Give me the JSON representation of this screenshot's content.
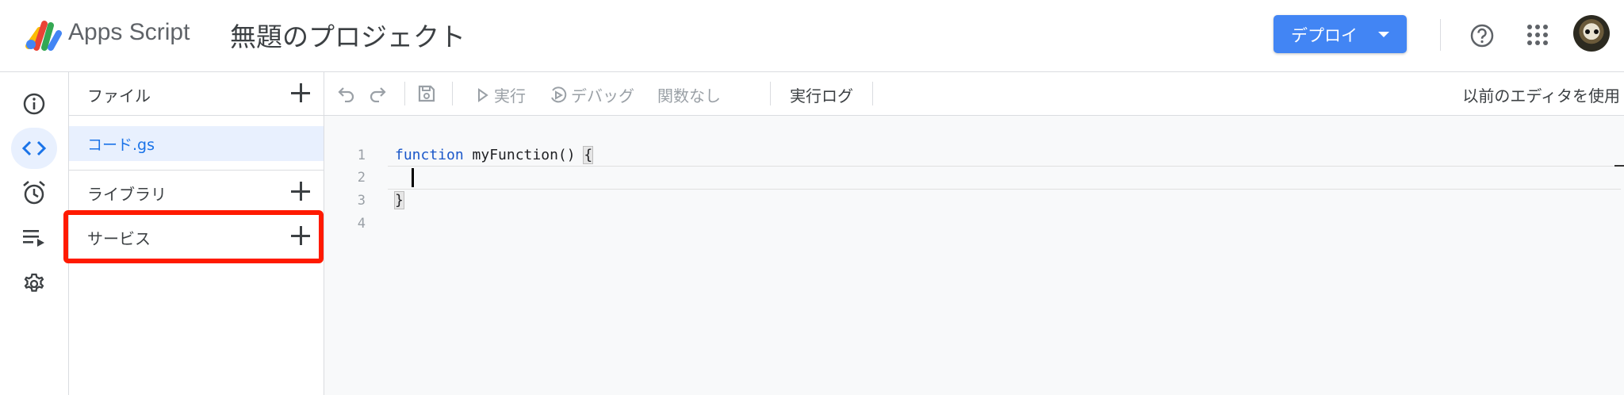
{
  "header": {
    "app_name": "Apps Script",
    "project_title": "無題のプロジェクト",
    "deploy_label": "デプロイ",
    "icons": [
      "apps-script-logo",
      "help-icon",
      "apps-grid-icon",
      "avatar"
    ]
  },
  "rail": {
    "items": [
      {
        "name": "overview",
        "icon": "info-icon",
        "active": false
      },
      {
        "name": "editor",
        "icon": "code-icon",
        "active": true
      },
      {
        "name": "triggers",
        "icon": "alarm-icon",
        "active": false
      },
      {
        "name": "executions",
        "icon": "list-play-icon",
        "active": false
      },
      {
        "name": "settings",
        "icon": "gear-icon",
        "active": false
      }
    ]
  },
  "files_panel": {
    "files_label": "ファイル",
    "files": [
      "コード.gs"
    ],
    "libraries_label": "ライブラリ",
    "services_label": "サービス"
  },
  "toolbar": {
    "run_label": "実行",
    "debug_label": "デバッグ",
    "function_select": "関数なし",
    "log_label": "実行ログ",
    "legacy_label": "以前のエディタを使用"
  },
  "editor": {
    "line_numbers": [
      "1",
      "2",
      "3",
      "4"
    ],
    "line1_keyword": "function",
    "line1_rest": " myFunction() ",
    "open_brace": "{",
    "close_brace": "}"
  },
  "colors": {
    "accent": "#4285f4",
    "link": "#1a73e8",
    "annotation": "#ff1a00",
    "selected_bg": "#e8f0fe"
  }
}
